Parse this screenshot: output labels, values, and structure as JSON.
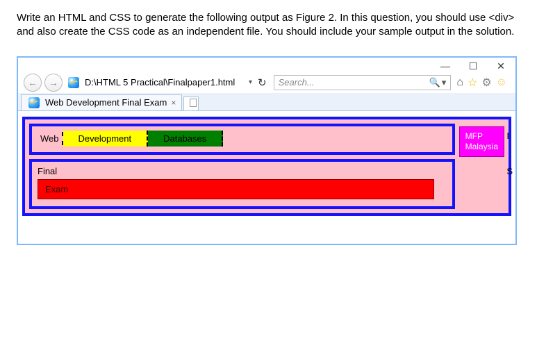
{
  "question": {
    "text": "Write an HTML and CSS to generate the following output as Figure 2. In this question, you should use <div> and also create the CSS code as an independent file. You should include your sample output in the solution."
  },
  "window": {
    "minimize": "—",
    "maximize": "☐",
    "close": "✕"
  },
  "toolbar": {
    "back": "←",
    "forward": "→",
    "address": "D:\\HTML 5 Practical\\Finalpaper1.html",
    "dropdown": "▾",
    "refresh": "↻",
    "search_placeholder": "Search...",
    "magnify": "🔍",
    "mag_drop": "▾",
    "home": "⌂",
    "star": "☆",
    "gear": "⚙",
    "smile": "☺"
  },
  "tab": {
    "title": "Web Development Final Exam",
    "close": "×"
  },
  "page": {
    "web": "Web",
    "development": "Development",
    "databases": "Databases",
    "final": "Final",
    "exam": "Exam",
    "mfp_line1": "MFP",
    "mfp_line2": "Malaysia"
  },
  "overflow": {
    "mark1": "I",
    "mark2": "S"
  }
}
